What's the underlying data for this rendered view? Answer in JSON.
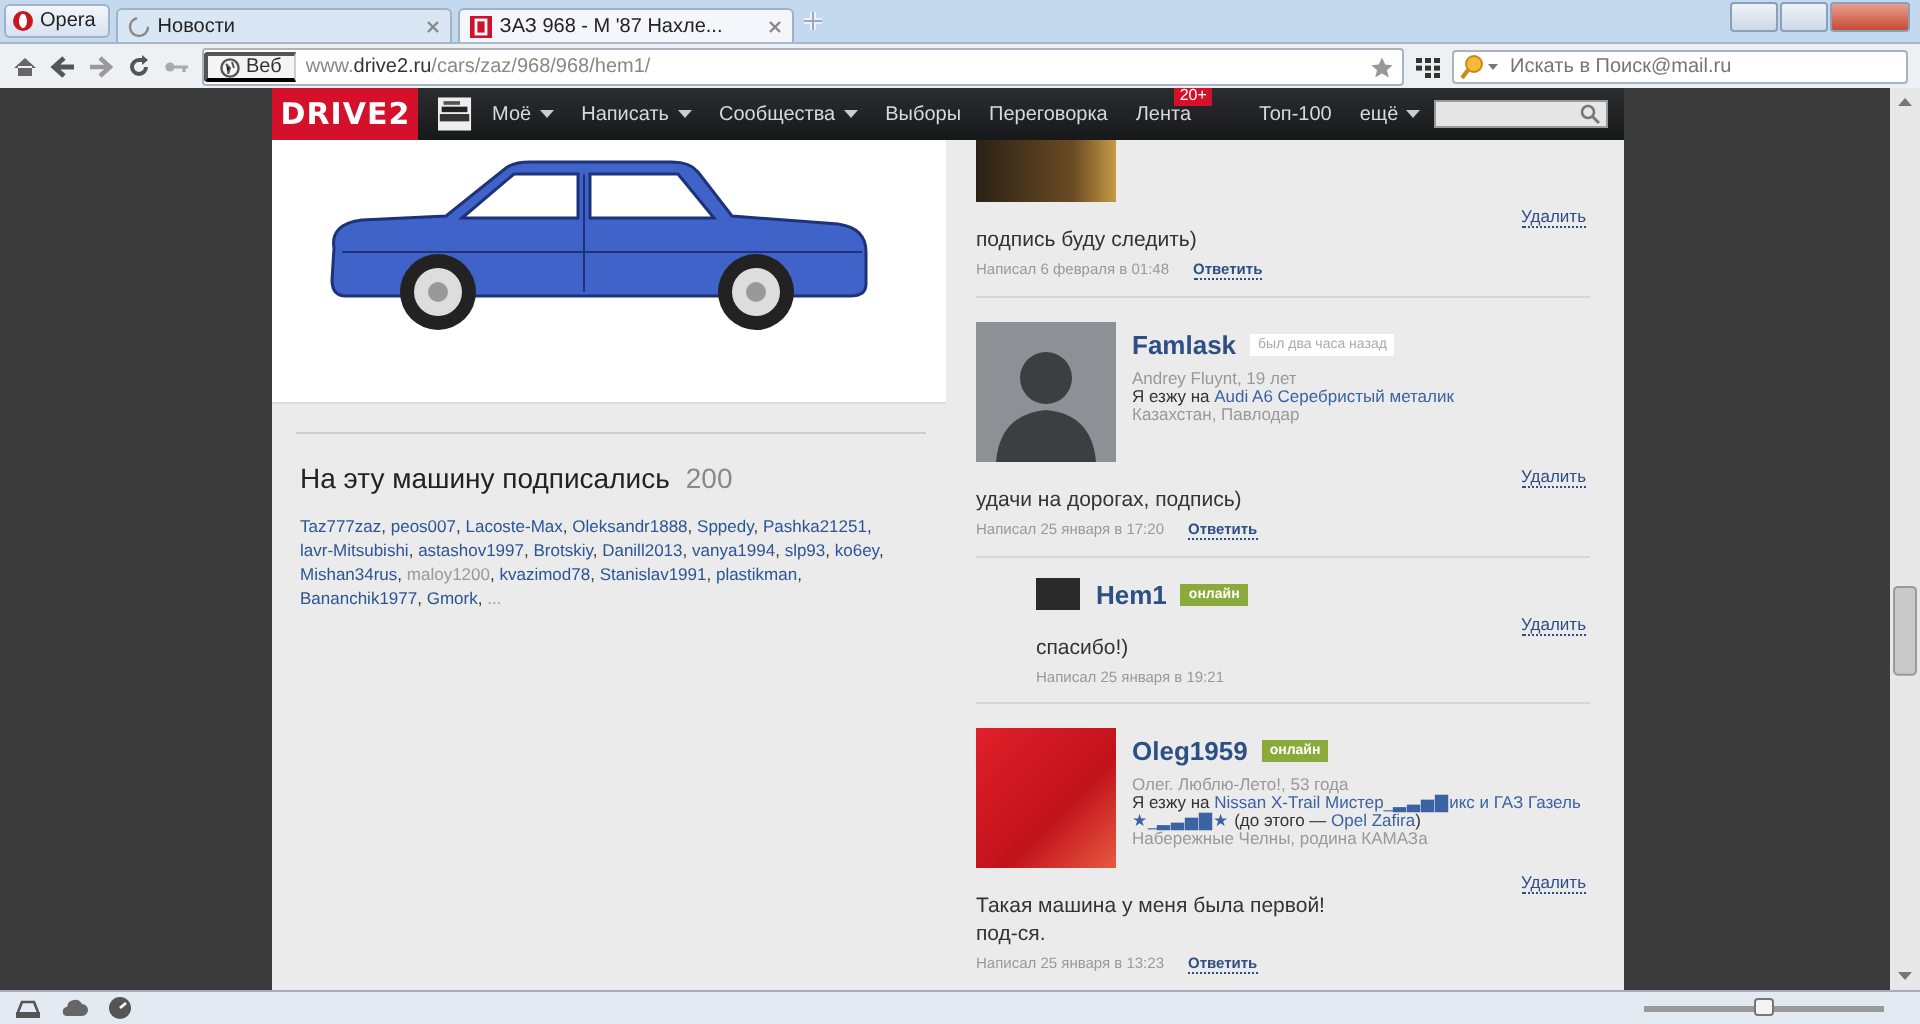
{
  "browser": {
    "menu_button": "Opera",
    "tabs": [
      {
        "label": "Новости",
        "selected": false
      },
      {
        "label": "ЗАЗ 968 - М '87 Нахле...",
        "selected": true
      }
    ],
    "address_button": "Веб",
    "address": "www.**drive2.ru**/cars/zaz/968/968/hem1/",
    "search": {
      "placeholder": "Искать в Поиск@mail.ru"
    }
  },
  "site_nav": {
    "logo": "DRIVE2",
    "items": [
      {
        "label": "Моё",
        "menu": true
      },
      {
        "label": "Написать",
        "menu": true
      },
      {
        "label": "Сообщества",
        "menu": true
      },
      {
        "label": "Выборы",
        "menu": false
      },
      {
        "label": "Переговорка",
        "menu": false
      },
      {
        "label": "Лента",
        "menu": false,
        "badge": "20+"
      },
      {
        "label": "Топ-100",
        "menu": false
      },
      {
        "label": "ещё",
        "menu": true
      }
    ]
  },
  "subscribers": {
    "title": "На эту машину подписались",
    "count": "200",
    "names": [
      {
        "name": "Taz777zaz",
        "inactive": false
      },
      {
        "name": "peos007",
        "inactive": false
      },
      {
        "name": "Lacoste-Max",
        "inactive": false
      },
      {
        "name": "Oleksandr1888",
        "inactive": false
      },
      {
        "name": "Sppedy",
        "inactive": false
      },
      {
        "name": "Pashka21251",
        "inactive": false
      },
      {
        "name": "lavr-Mitsubishi",
        "inactive": false
      },
      {
        "name": "astashov1997",
        "inactive": false
      },
      {
        "name": "Brotskiy",
        "inactive": false
      },
      {
        "name": "Danill2013",
        "inactive": false
      },
      {
        "name": "vanya1994",
        "inactive": false
      },
      {
        "name": "slp93",
        "inactive": false
      },
      {
        "name": "ko6ey",
        "inactive": false
      },
      {
        "name": "Mishan34rus",
        "inactive": false
      },
      {
        "name": "maloy1200",
        "inactive": true
      },
      {
        "name": "kvazimod78",
        "inactive": false
      },
      {
        "name": "Stanislav1991",
        "inactive": false
      },
      {
        "name": "plastikman",
        "inactive": false
      },
      {
        "name": "Bananchik1977",
        "inactive": false
      },
      {
        "name": "Gmork",
        "inactive": false
      }
    ],
    "separator": ",",
    "more": "..."
  },
  "comments": [
    {
      "kind": "partial",
      "avatar": {
        "kind": "photo"
      },
      "delete": "Удалить",
      "text": "подпись буду следить)",
      "date": "Написал 6 февраля в 01:48",
      "reply": "Ответить"
    },
    {
      "kind": "full",
      "avatar": {
        "kind": "silhouette"
      },
      "name": "Famlask",
      "status": "был два часа назад",
      "online": false,
      "about": "Andrey Fluynt, 19 лет",
      "drives": [
        {
          "text": "Я езжу на ",
          "link": false
        },
        {
          "text": "Audi A6 Серебристый металик",
          "link": true
        }
      ],
      "location": "Казахстан, Павлодар",
      "delete": "Удалить",
      "text": "удачи на дорогах, подпись)",
      "date": "Написал 25 января в 17:20",
      "reply": "Ответить"
    },
    {
      "kind": "reply",
      "avatar": {
        "kind": "photo"
      },
      "name": "Hem1",
      "status": "онлайн",
      "online": true,
      "delete": "Удалить",
      "text": "спасибо!)",
      "date": "Написал 25 января в 19:21"
    },
    {
      "kind": "full",
      "avatar": {
        "kind": "photo"
      },
      "name": "Oleg1959",
      "status": "онлайн",
      "online": true,
      "about": "Олег. Люблю-Лето!, 53 года",
      "drives": [
        {
          "text": "Я езжу на ",
          "link": false
        },
        {
          "text": "Nissan X-Trail Мистер_▂▃▅▇икс и ГАЗ Газель",
          "link": true
        },
        {
          "text": "★_▂▃▅▇★",
          "link": true
        },
        {
          "text": " (до этого — ",
          "link": false
        },
        {
          "text": "Opel Zafira",
          "link": true
        },
        {
          "text": ")",
          "link": false
        }
      ],
      "location": "Набережные Челны, родина КАМАЗа",
      "delete": "Удалить",
      "text": "Такая машина у меня была первой!\nпод-ся.",
      "date": "Написал 25 января в 13:23",
      "reply": "Ответить"
    }
  ],
  "zoom_slider": {
    "level": 0.5
  }
}
